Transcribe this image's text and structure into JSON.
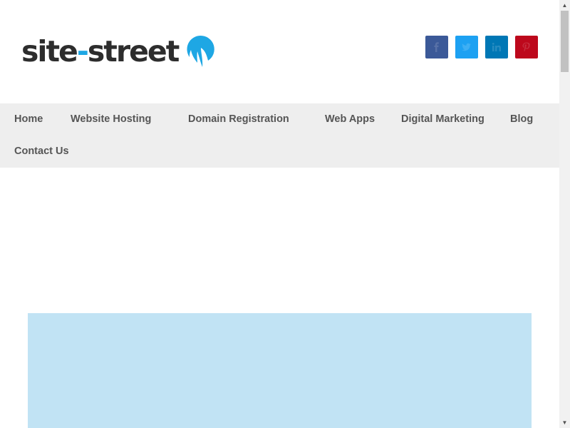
{
  "brand": {
    "name_part1": "site",
    "name_dash": "-",
    "name_part2": "street",
    "accent_color": "#1ea7e4",
    "text_color": "#2d2d2d"
  },
  "social": [
    {
      "name": "facebook-icon",
      "color": "#3b5998"
    },
    {
      "name": "twitter-icon",
      "color": "#1da1f2"
    },
    {
      "name": "linkedin-icon",
      "color": "#0077b5"
    },
    {
      "name": "pinterest-icon",
      "color": "#bd081c"
    }
  ],
  "nav": {
    "items": [
      {
        "label": "Home"
      },
      {
        "label": "Website Hosting"
      },
      {
        "label": "Domain Registration"
      },
      {
        "label": "Web Apps"
      },
      {
        "label": "Digital Marketing"
      },
      {
        "label": "Blog"
      },
      {
        "label": "Contact Us"
      }
    ]
  },
  "colors": {
    "nav_background": "#eeeeee",
    "nav_text": "#555555",
    "banner_background": "#c1e3f4"
  }
}
